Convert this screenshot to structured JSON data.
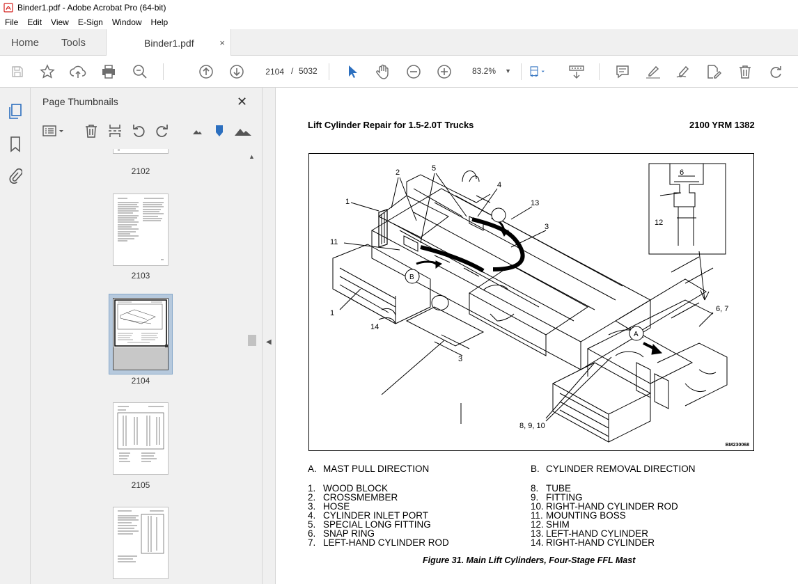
{
  "window": {
    "title": "Binder1.pdf - Adobe Acrobat Pro (64-bit)"
  },
  "menu": [
    "File",
    "Edit",
    "View",
    "E-Sign",
    "Window",
    "Help"
  ],
  "tabs": {
    "home": "Home",
    "tools": "Tools",
    "document": "Binder1.pdf",
    "close_glyph": "×"
  },
  "toolbar": {
    "page_current": "2104",
    "page_separator": "/",
    "page_total": "5032",
    "zoom": "83.2%",
    "icons": [
      "save-icon",
      "bookmark-star-icon",
      "upload-icon",
      "print-icon",
      "find-icon",
      "prev-page-icon",
      "next-page-icon",
      "select-cursor-icon",
      "hand-icon",
      "zoom-out-icon",
      "zoom-in-icon",
      "fit-page-icon",
      "scroll-mode-icon",
      "comment-icon",
      "highlight-icon",
      "sign-icon",
      "edit-pdf-icon",
      "delete-icon",
      "rotate-icon"
    ]
  },
  "left_rail": {
    "icons": [
      "page-thumbnails-icon",
      "bookmarks-icon",
      "attachments-icon"
    ]
  },
  "thumbnail_panel": {
    "title": "Page Thumbnails",
    "close_glyph": "✕",
    "pages": [
      {
        "label": "2102"
      },
      {
        "label": "2103"
      },
      {
        "label": "2104",
        "selected": true
      },
      {
        "label": "2105"
      },
      {
        "label": ""
      }
    ]
  },
  "document": {
    "header_left": "Lift Cylinder Repair for 1.5-2.0T Trucks",
    "header_right": "2100 YRM 1382",
    "figure_id": "BM230068",
    "callouts": [
      "1",
      "2",
      "5",
      "4",
      "13",
      "3",
      "11",
      "B",
      "1",
      "14",
      "3",
      "6",
      "12",
      "A",
      "6, 7",
      "8, 9, 10"
    ],
    "legend_left": [
      {
        "num": "A.",
        "text": "MAST PULL DIRECTION"
      },
      {
        "num": "",
        "text": ""
      },
      {
        "num": "1.",
        "text": "WOOD BLOCK"
      },
      {
        "num": "2.",
        "text": "CROSSMEMBER"
      },
      {
        "num": "3.",
        "text": "HOSE"
      },
      {
        "num": "4.",
        "text": "CYLINDER INLET PORT"
      },
      {
        "num": "5.",
        "text": "SPECIAL LONG FITTING"
      },
      {
        "num": "6.",
        "text": "SNAP RING"
      },
      {
        "num": "7.",
        "text": "LEFT-HAND CYLINDER ROD"
      }
    ],
    "legend_right": [
      {
        "num": "B.",
        "text": "CYLINDER REMOVAL DIRECTION"
      },
      {
        "num": "",
        "text": ""
      },
      {
        "num": "8.",
        "text": "TUBE"
      },
      {
        "num": "9.",
        "text": "FITTING"
      },
      {
        "num": "10.",
        "text": "RIGHT-HAND CYLINDER ROD"
      },
      {
        "num": "11.",
        "text": "MOUNTING BOSS"
      },
      {
        "num": "12.",
        "text": "SHIM"
      },
      {
        "num": "13.",
        "text": "LEFT-HAND CYLINDER"
      },
      {
        "num": "14.",
        "text": "RIGHT-HAND CYLINDER"
      }
    ],
    "caption": "Figure 31. Main Lift Cylinders, Four-Stage FFL Mast"
  },
  "colors": {
    "accent_blue": "#2c6fbf",
    "icon_gray": "#6d6d6d",
    "selection": "#b6c9dd",
    "pdf_red": "#d4211e"
  }
}
